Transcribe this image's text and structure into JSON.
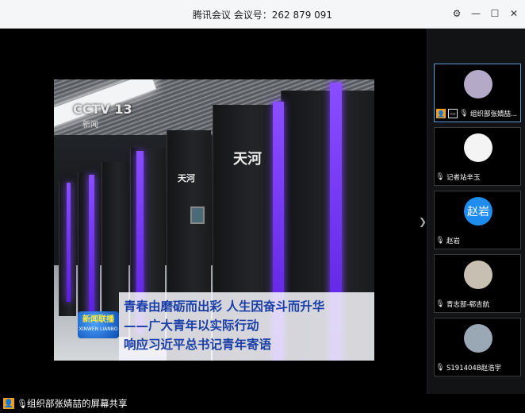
{
  "window": {
    "title": "腾讯会议 会议号：262 879 091",
    "controls": [
      "⚙",
      "—",
      "☐",
      "✕"
    ]
  },
  "shared_screen": {
    "channel_logo": "CCTV 13",
    "channel_sub": "新闻",
    "supercomputer_label": "天河",
    "news_logo": "新闻联播",
    "news_logo_sub": "XINWEN LIANBO",
    "caption_lines": [
      "青春由磨砺而出彩 人生因奋斗而升华",
      "——广大青年以实际行动",
      "响应习近平总书记青年寄语"
    ]
  },
  "participants": [
    {
      "name": "组织部张婧喆...",
      "active": true,
      "avatar_color": "#b4a9c6",
      "avatar_text": ""
    },
    {
      "name": "记者站辛玉",
      "active": false,
      "avatar_color": "#f4f4f4",
      "avatar_text": ""
    },
    {
      "name": "赵岩",
      "active": false,
      "avatar_color": "#1f8cf0",
      "avatar_text": "赵岩"
    },
    {
      "name": "青志部-郗吉航",
      "active": false,
      "avatar_color": "#c8bfb3",
      "avatar_text": ""
    },
    {
      "name": "S191404B赵浩宇",
      "active": false,
      "avatar_color": "#9aa7b5",
      "avatar_text": ""
    }
  ],
  "footer": {
    "status": "组织部张婧喆的屏幕共享"
  }
}
